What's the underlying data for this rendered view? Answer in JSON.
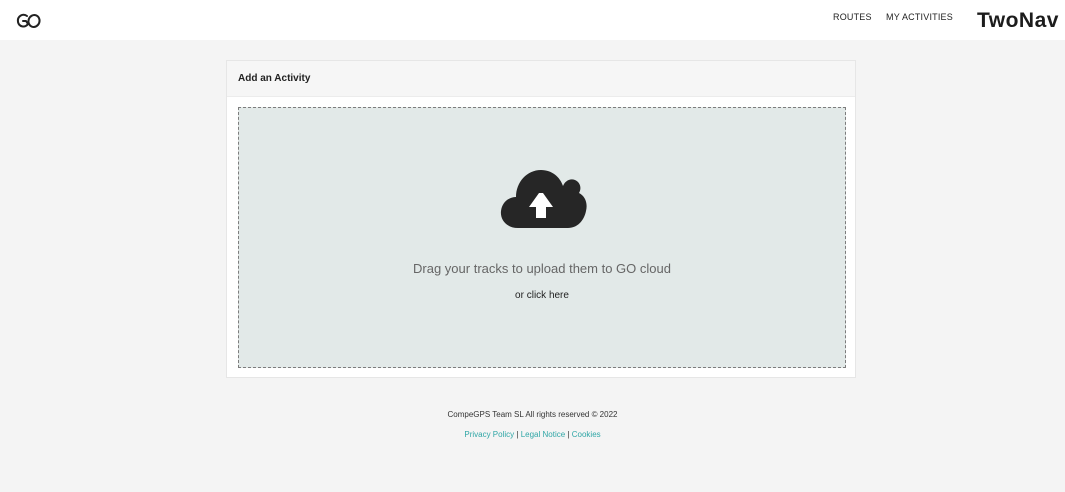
{
  "header": {
    "logo_icon": "go-logo-icon",
    "nav": {
      "routes": "ROUTES",
      "my_activities": "MY ACTIVITIES"
    },
    "brand": "TwoNav"
  },
  "card": {
    "title": "Add an Activity",
    "dropzone": {
      "icon": "cloud-upload-icon",
      "instruction": "Drag your tracks to upload them to GO cloud",
      "click_label": "or click here"
    }
  },
  "footer": {
    "copyright": "CompeGPS Team SL All rights reserved © 2022",
    "links": {
      "privacy": "Privacy Policy",
      "legal": "Legal Notice",
      "cookies": "Cookies",
      "separator": "|"
    }
  },
  "colors": {
    "background": "#f4f4f4",
    "dropzone": "#e2e9e8",
    "link": "#2fa6a6",
    "icon": "#262626"
  }
}
